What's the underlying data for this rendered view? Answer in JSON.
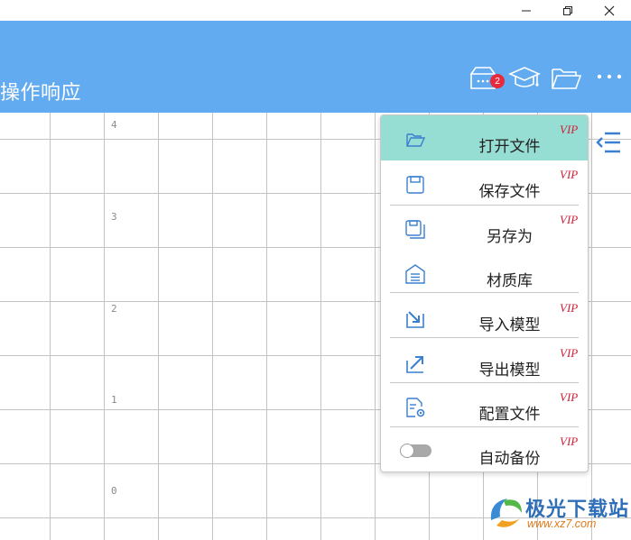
{
  "window": {
    "minimize_icon": "minimize-icon",
    "restore_icon": "restore-icon",
    "close_icon": "close-icon"
  },
  "header": {
    "title": "操作响应",
    "background": "#62ABF0",
    "icons": [
      "inbox-icon",
      "graduation-cap-icon",
      "folder-icon",
      "more-icon"
    ],
    "notification_count": "2"
  },
  "grid": {
    "y_labels": [
      "4",
      "3",
      "2",
      "1",
      "0"
    ]
  },
  "menu": {
    "items": [
      {
        "label": "打开文件",
        "icon": "open-folder-icon",
        "vip": "VIP",
        "active": true
      },
      {
        "label": "保存文件",
        "icon": "save-icon",
        "vip": "VIP"
      },
      {
        "label": "另存为",
        "icon": "save-as-icon",
        "vip": "VIP"
      },
      {
        "label": "材质库",
        "icon": "warehouse-icon",
        "vip": ""
      },
      {
        "label": "导入模型",
        "icon": "import-icon",
        "vip": "VIP"
      },
      {
        "label": "导出模型",
        "icon": "export-icon",
        "vip": "VIP"
      },
      {
        "label": "配置文件",
        "icon": "config-file-icon",
        "vip": "VIP"
      },
      {
        "label": "自动备份",
        "icon": "toggle-switch",
        "vip": "VIP",
        "toggle_on": false
      }
    ],
    "active_color": "#96DDD3",
    "vip_color": "#D0203A"
  },
  "side": {
    "collapse_icon": "collapse-menu-icon"
  },
  "watermark": {
    "brand": "极光下载站",
    "url": "www.xz7.com"
  }
}
